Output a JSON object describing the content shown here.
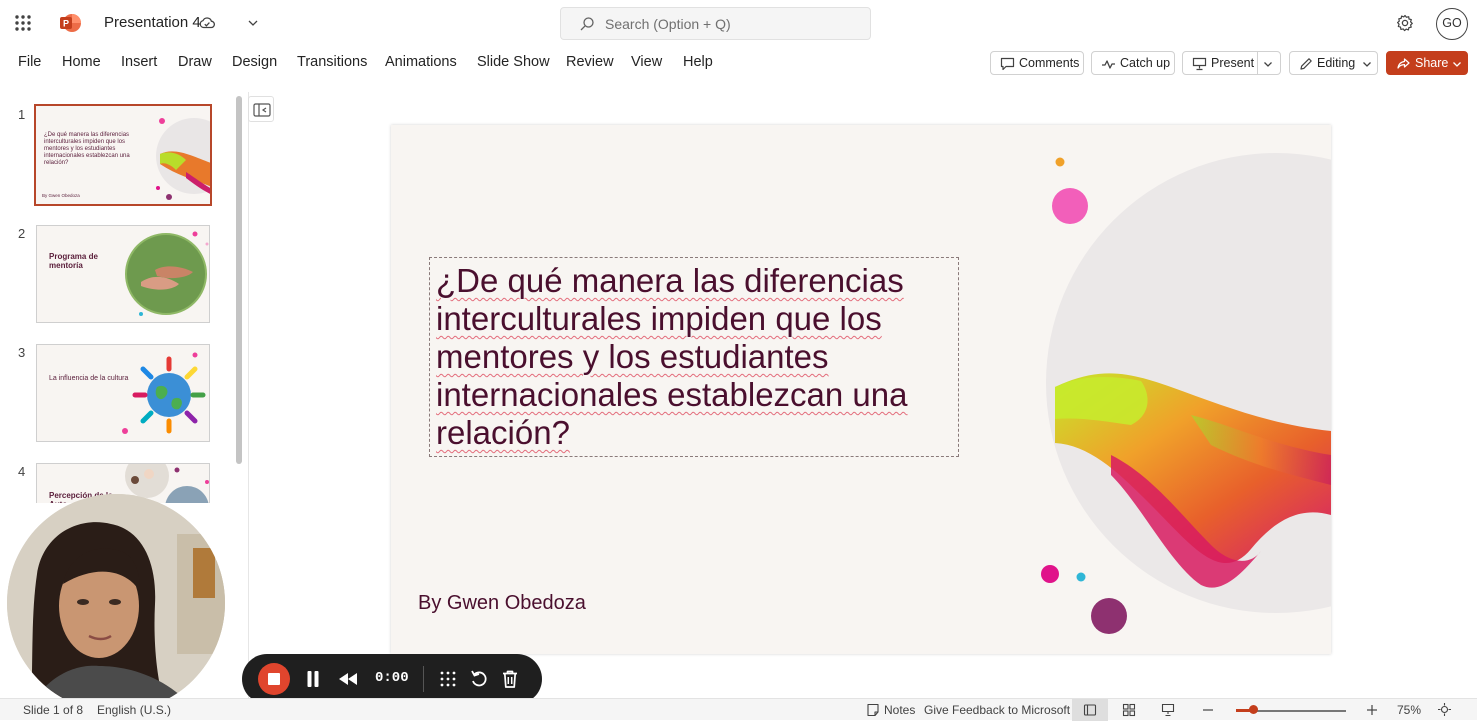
{
  "app": {
    "doc_title": "Presentation 4",
    "search_placeholder": "Search (Option + Q)",
    "user_initials": "GO",
    "brand_color": "#c43e1c"
  },
  "ribbon": {
    "tabs": [
      "File",
      "Home",
      "Insert",
      "Draw",
      "Design",
      "Transitions",
      "Animations",
      "Slide Show",
      "Review",
      "View",
      "Help"
    ],
    "comments_label": "Comments",
    "catchup_label": "Catch up",
    "present_label": "Present",
    "editing_label": "Editing",
    "share_label": "Share"
  },
  "thumbnails": [
    {
      "number": "1",
      "text": "¿De qué manera las diferencias interculturales impiden que los mentores y los estudiantes internacionales establezcan una relación?",
      "byline": "By Gwen Obedoza",
      "selected": true
    },
    {
      "number": "2",
      "text": "Programa de mentoría",
      "selected": false
    },
    {
      "number": "3",
      "text": "La influencia de la cultura",
      "selected": false
    },
    {
      "number": "4",
      "text": "Percepción de la Auto",
      "selected": false
    }
  ],
  "slide": {
    "title": "¿De qué manera las diferencias interculturales impiden que los mentores y los estudiantes internacionales establezcan una relación?",
    "subtitle": "By Gwen Obedoza"
  },
  "recorder": {
    "time": "0:00"
  },
  "status": {
    "slide_counter": "Slide 1 of 8",
    "language": "English (U.S.)",
    "notes_label": "Notes",
    "feedback_label": "Give Feedback to Microsoft",
    "zoom_level": "75%"
  }
}
